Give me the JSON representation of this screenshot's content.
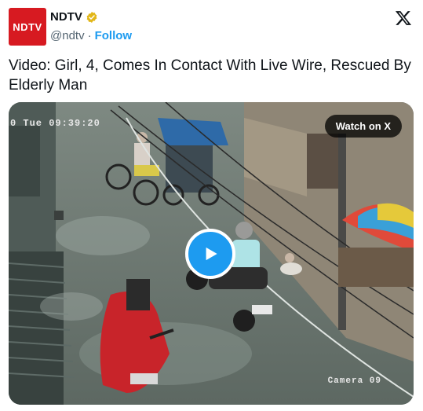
{
  "header": {
    "avatar_text": "NDTV",
    "display_name": "NDTV",
    "handle": "@ndtv",
    "separator": "·",
    "follow_label": "Follow"
  },
  "tweet": {
    "text": "Video: Girl, 4, Comes In Contact With Live Wire, Rescued By Elderly Man"
  },
  "media": {
    "timestamp": "0 Tue 09:39:20",
    "camera_label": "Camera 09",
    "watch_label": "Watch on X"
  },
  "icons": {
    "verified": "verified-badge-icon",
    "x_logo": "x-logo-icon",
    "play": "play-icon"
  },
  "colors": {
    "brand_red": "#d71a21",
    "link_blue": "#1d9bf0",
    "verified_gold": "#e2b719",
    "text_dark": "#0f1419",
    "text_muted": "#536471"
  }
}
